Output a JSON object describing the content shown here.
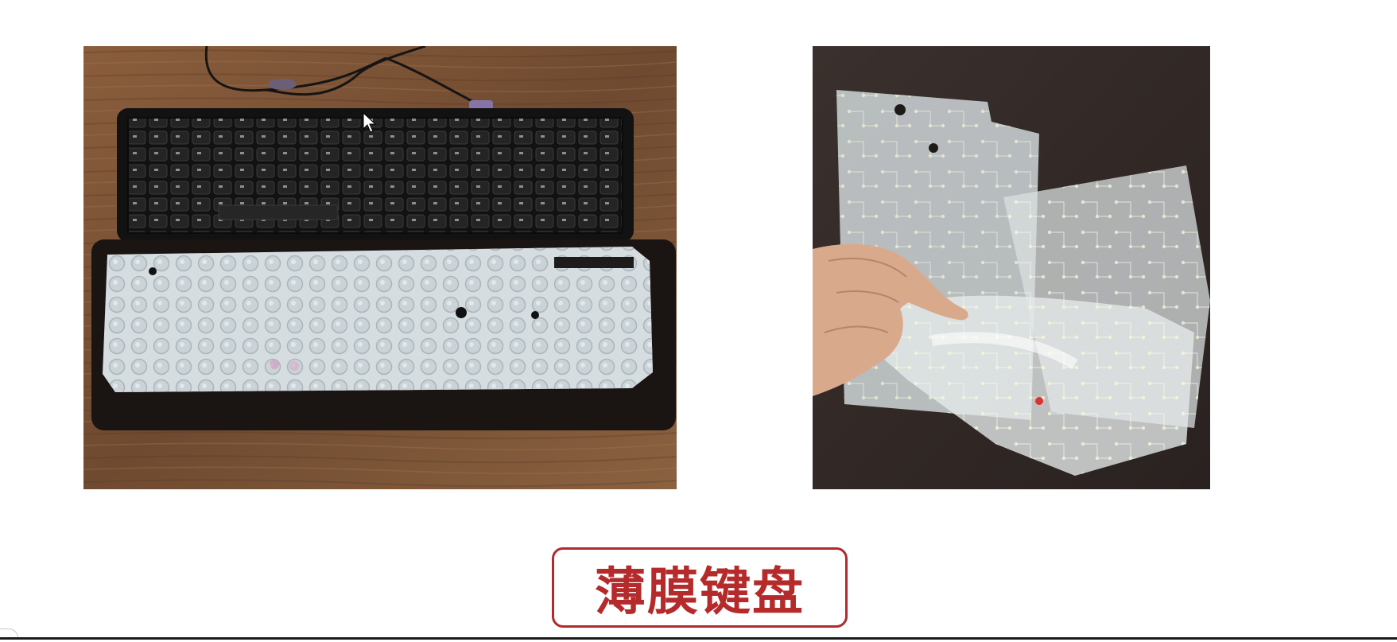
{
  "caption": {
    "text": "薄膜键盘"
  },
  "images": {
    "left": {
      "icon": "keyboard-disassembled-photo"
    },
    "right": {
      "icon": "membrane-sheet-photo"
    }
  },
  "colors": {
    "caption_border": "#b02b2b",
    "caption_text": "#b52a2a",
    "wood": "#7a5236",
    "keyboard": "#161616",
    "membrane": "#d8dde0",
    "dark_bg": "#2e2624"
  }
}
